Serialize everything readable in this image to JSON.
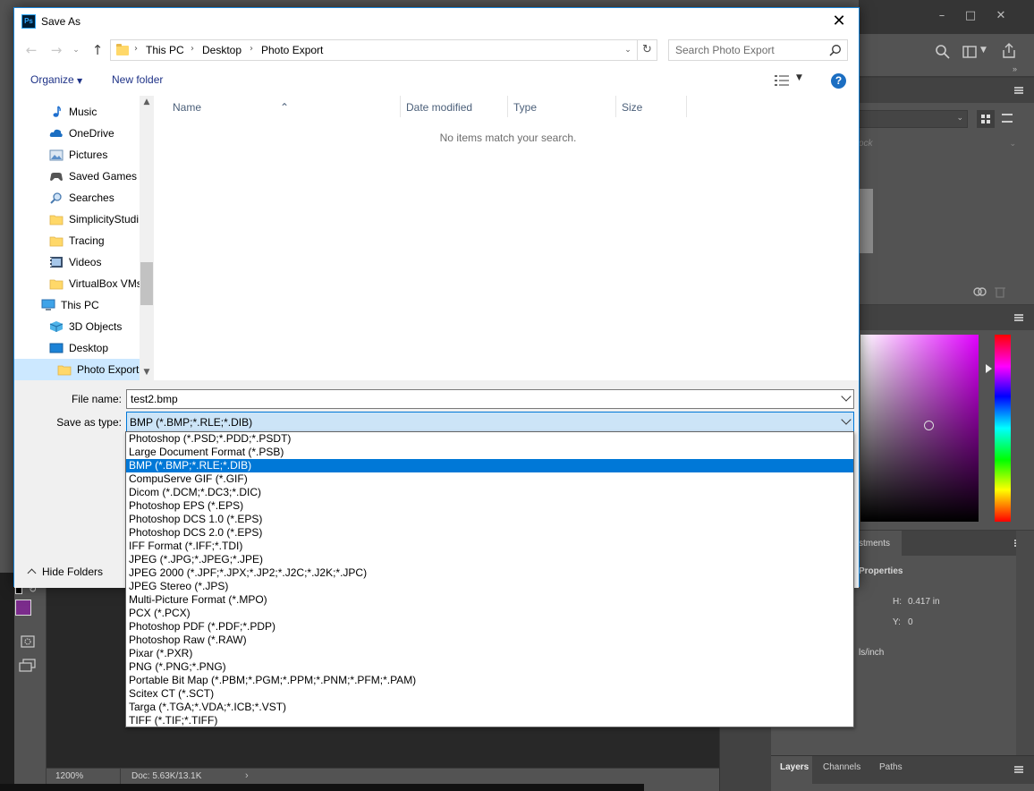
{
  "dialog": {
    "title": "Save As",
    "breadcrumb": [
      "This PC",
      "Desktop",
      "Photo Export"
    ],
    "search_placeholder": "Search Photo Export",
    "organize_label": "Organize",
    "new_folder_label": "New folder",
    "help_label": "?",
    "nav_items": [
      {
        "label": "Music",
        "icon": "music-icon"
      },
      {
        "label": "OneDrive",
        "icon": "cloud-icon"
      },
      {
        "label": "Pictures",
        "icon": "pictures-icon"
      },
      {
        "label": "Saved Games",
        "icon": "saved-games-icon"
      },
      {
        "label": "Searches",
        "icon": "search-icon"
      },
      {
        "label": "SimplicityStudi",
        "icon": "folder-icon"
      },
      {
        "label": "Tracing",
        "icon": "folder-icon"
      },
      {
        "label": "Videos",
        "icon": "videos-icon"
      },
      {
        "label": "VirtualBox VMs",
        "icon": "folder-icon"
      },
      {
        "label": "This PC",
        "icon": "computer-icon"
      },
      {
        "label": "3D Objects",
        "icon": "cube-icon"
      },
      {
        "label": "Desktop",
        "icon": "desktop-icon"
      },
      {
        "label": "Photo Export",
        "icon": "folder-icon",
        "selected": true
      }
    ],
    "columns": [
      "Name",
      "Date modified",
      "Type",
      "Size"
    ],
    "empty_message": "No items match your search.",
    "file_name_label": "File name:",
    "file_name_value": "test2.bmp",
    "save_as_type_label": "Save as type:",
    "save_as_type_value": "BMP (*.BMP;*.RLE;*.DIB)",
    "hide_folders_label": "Hide Folders",
    "type_options": [
      "Photoshop (*.PSD;*.PDD;*.PSDT)",
      "Large Document Format (*.PSB)",
      "BMP (*.BMP;*.RLE;*.DIB)",
      "CompuServe GIF (*.GIF)",
      "Dicom (*.DCM;*.DC3;*.DIC)",
      "Photoshop EPS (*.EPS)",
      "Photoshop DCS 1.0 (*.EPS)",
      "Photoshop DCS 2.0 (*.EPS)",
      "IFF Format (*.IFF;*.TDI)",
      "JPEG (*.JPG;*.JPEG;*.JPE)",
      "JPEG 2000 (*.JPF;*.JPX;*.JP2;*.J2C;*.J2K;*.JPC)",
      "JPEG Stereo (*.JPS)",
      "Multi-Picture Format (*.MPO)",
      "PCX (*.PCX)",
      "Photoshop PDF (*.PDF;*.PDP)",
      "Photoshop Raw (*.RAW)",
      "Pixar (*.PXR)",
      "PNG (*.PNG;*.PNG)",
      "Portable Bit Map (*.PBM;*.PGM;*.PPM;*.PNM;*.PFM;*.PAM)",
      "Scitex CT (*.SCT)",
      "Targa (*.TGA;*.VDA;*.ICB;*.VST)",
      "TIFF (*.TIF;*.TIFF)"
    ],
    "selected_type_index": 2
  },
  "photoshop": {
    "zoom": "1200%",
    "doc_info": "Doc: 5.63K/13.1K",
    "panel_tabs": [
      "Layers",
      "Channels",
      "Paths"
    ],
    "adjustments_partial": "stments",
    "properties_partial": "Properties",
    "h_label": "H:",
    "h_value": "0.417 in",
    "y_label": "Y:",
    "y_value": "0",
    "resolution_partial": "ls/inch",
    "lock_partial": "ock",
    "foreground_color": "#7b2c8c",
    "picker_hue": "#e000ff"
  }
}
